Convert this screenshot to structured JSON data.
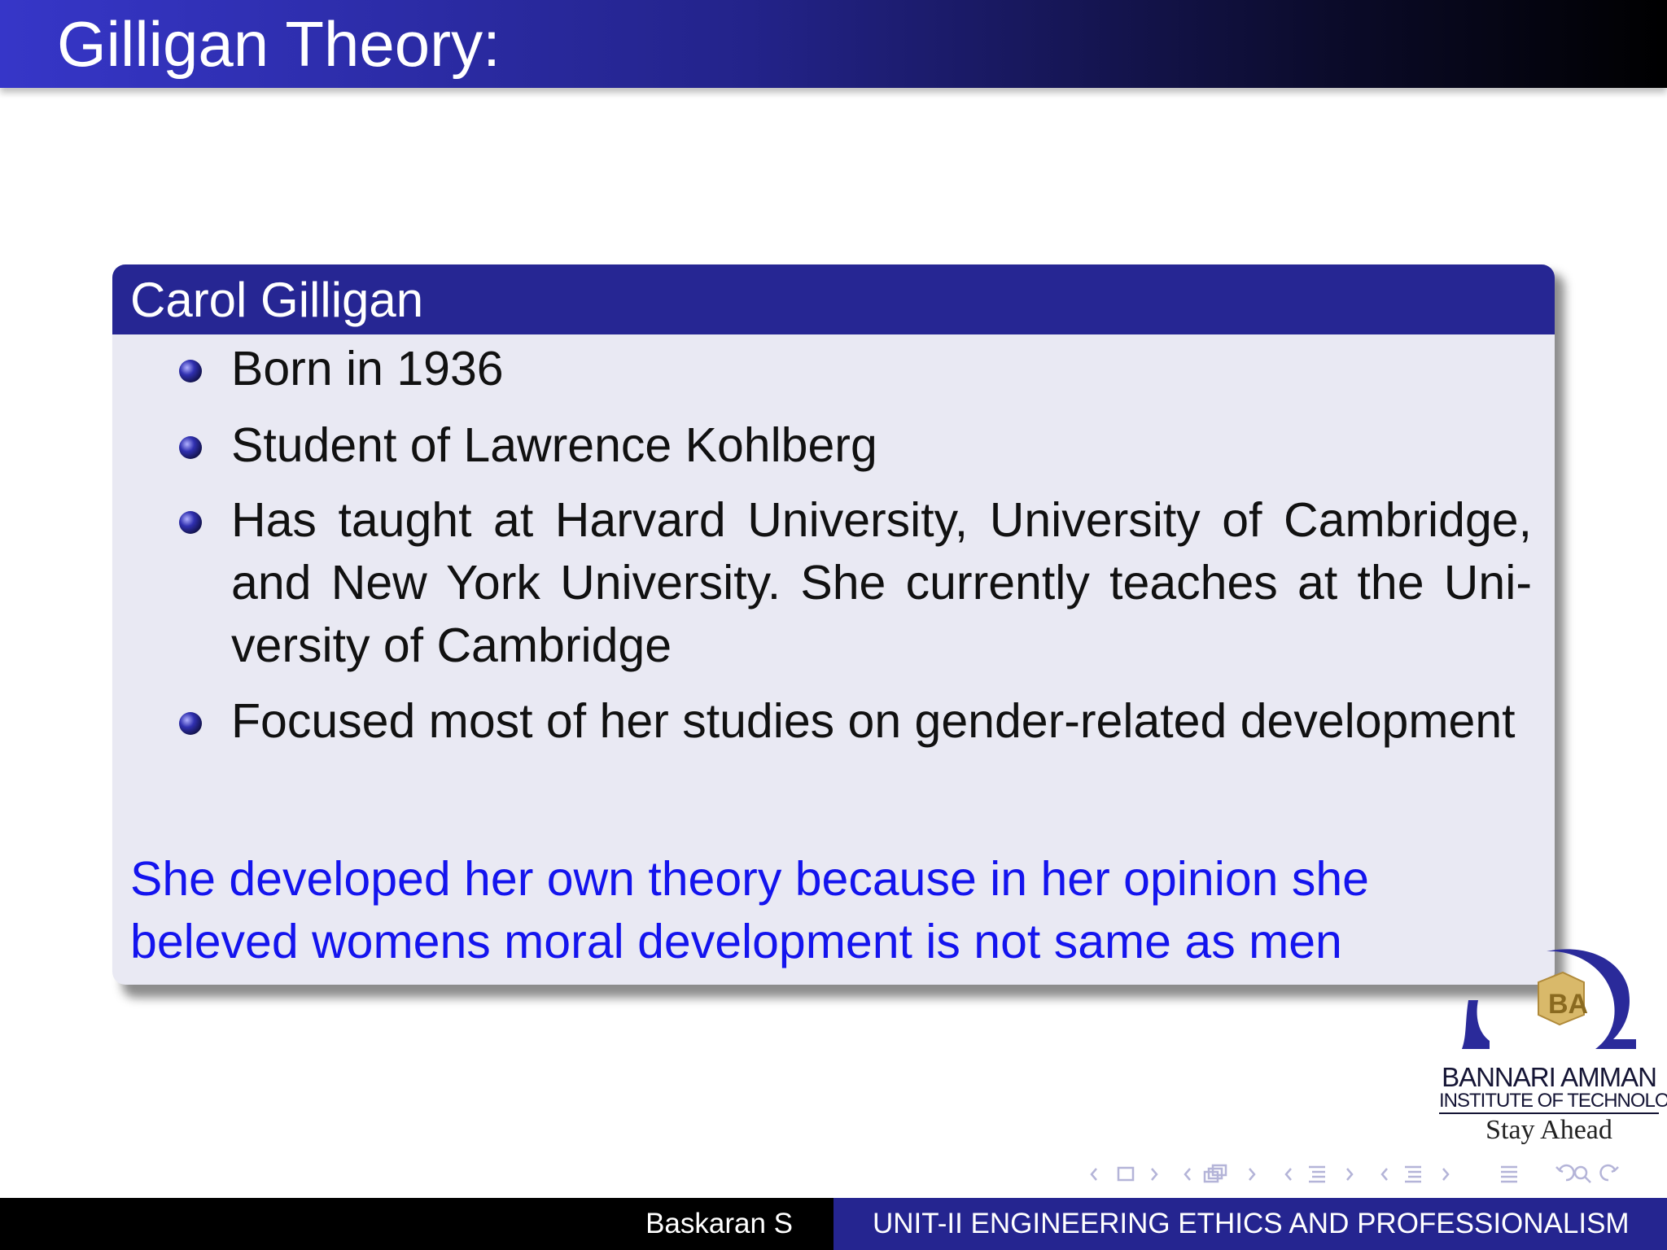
{
  "slide": {
    "title": "Gilligan Theory:"
  },
  "block": {
    "title": "Carol Gilligan",
    "bullets": [
      "Born in 1936",
      "Student of Lawrence Kohlberg",
      "Has taught at Harvard University, University of Cambridge, and New York University. She currently teaches at the Uni­versity of Cambridge",
      "Focused most of her studies on gender-related develop­ment"
    ],
    "note": "She developed her own theory because in her opinion she beleved womens moral development is not same as men"
  },
  "logo": {
    "monogram": "BA",
    "name": "BANNARI AMMAN",
    "subname": "INSTITUTE OF TECHNOLOGY",
    "tagline": "Stay Ahead"
  },
  "footer": {
    "author": "Baskaran S",
    "course": "UNIT-II ENGINEERING ETHICS AND PROFESSIONALISM"
  },
  "colors": {
    "title_bar_start": "#3636c8",
    "title_bar_end": "#000000",
    "block_header": "#262693",
    "block_body": "#e9e9f3",
    "note_text": "#1414ee",
    "footer_left": "#000000",
    "footer_right": "#252590"
  },
  "icons": {
    "nav": [
      "nav-prev-frame-icon",
      "nav-frame-icon",
      "nav-next-frame-icon",
      "nav-prev-slide-icon",
      "nav-slide-icon",
      "nav-next-slide-icon",
      "nav-prev-subsection-icon",
      "nav-subsection-icon",
      "nav-next-subsection-icon",
      "nav-prev-section-icon",
      "nav-section-icon",
      "nav-next-section-icon",
      "nav-document-icon",
      "nav-back-icon",
      "nav-search-icon",
      "nav-forward-icon"
    ]
  }
}
